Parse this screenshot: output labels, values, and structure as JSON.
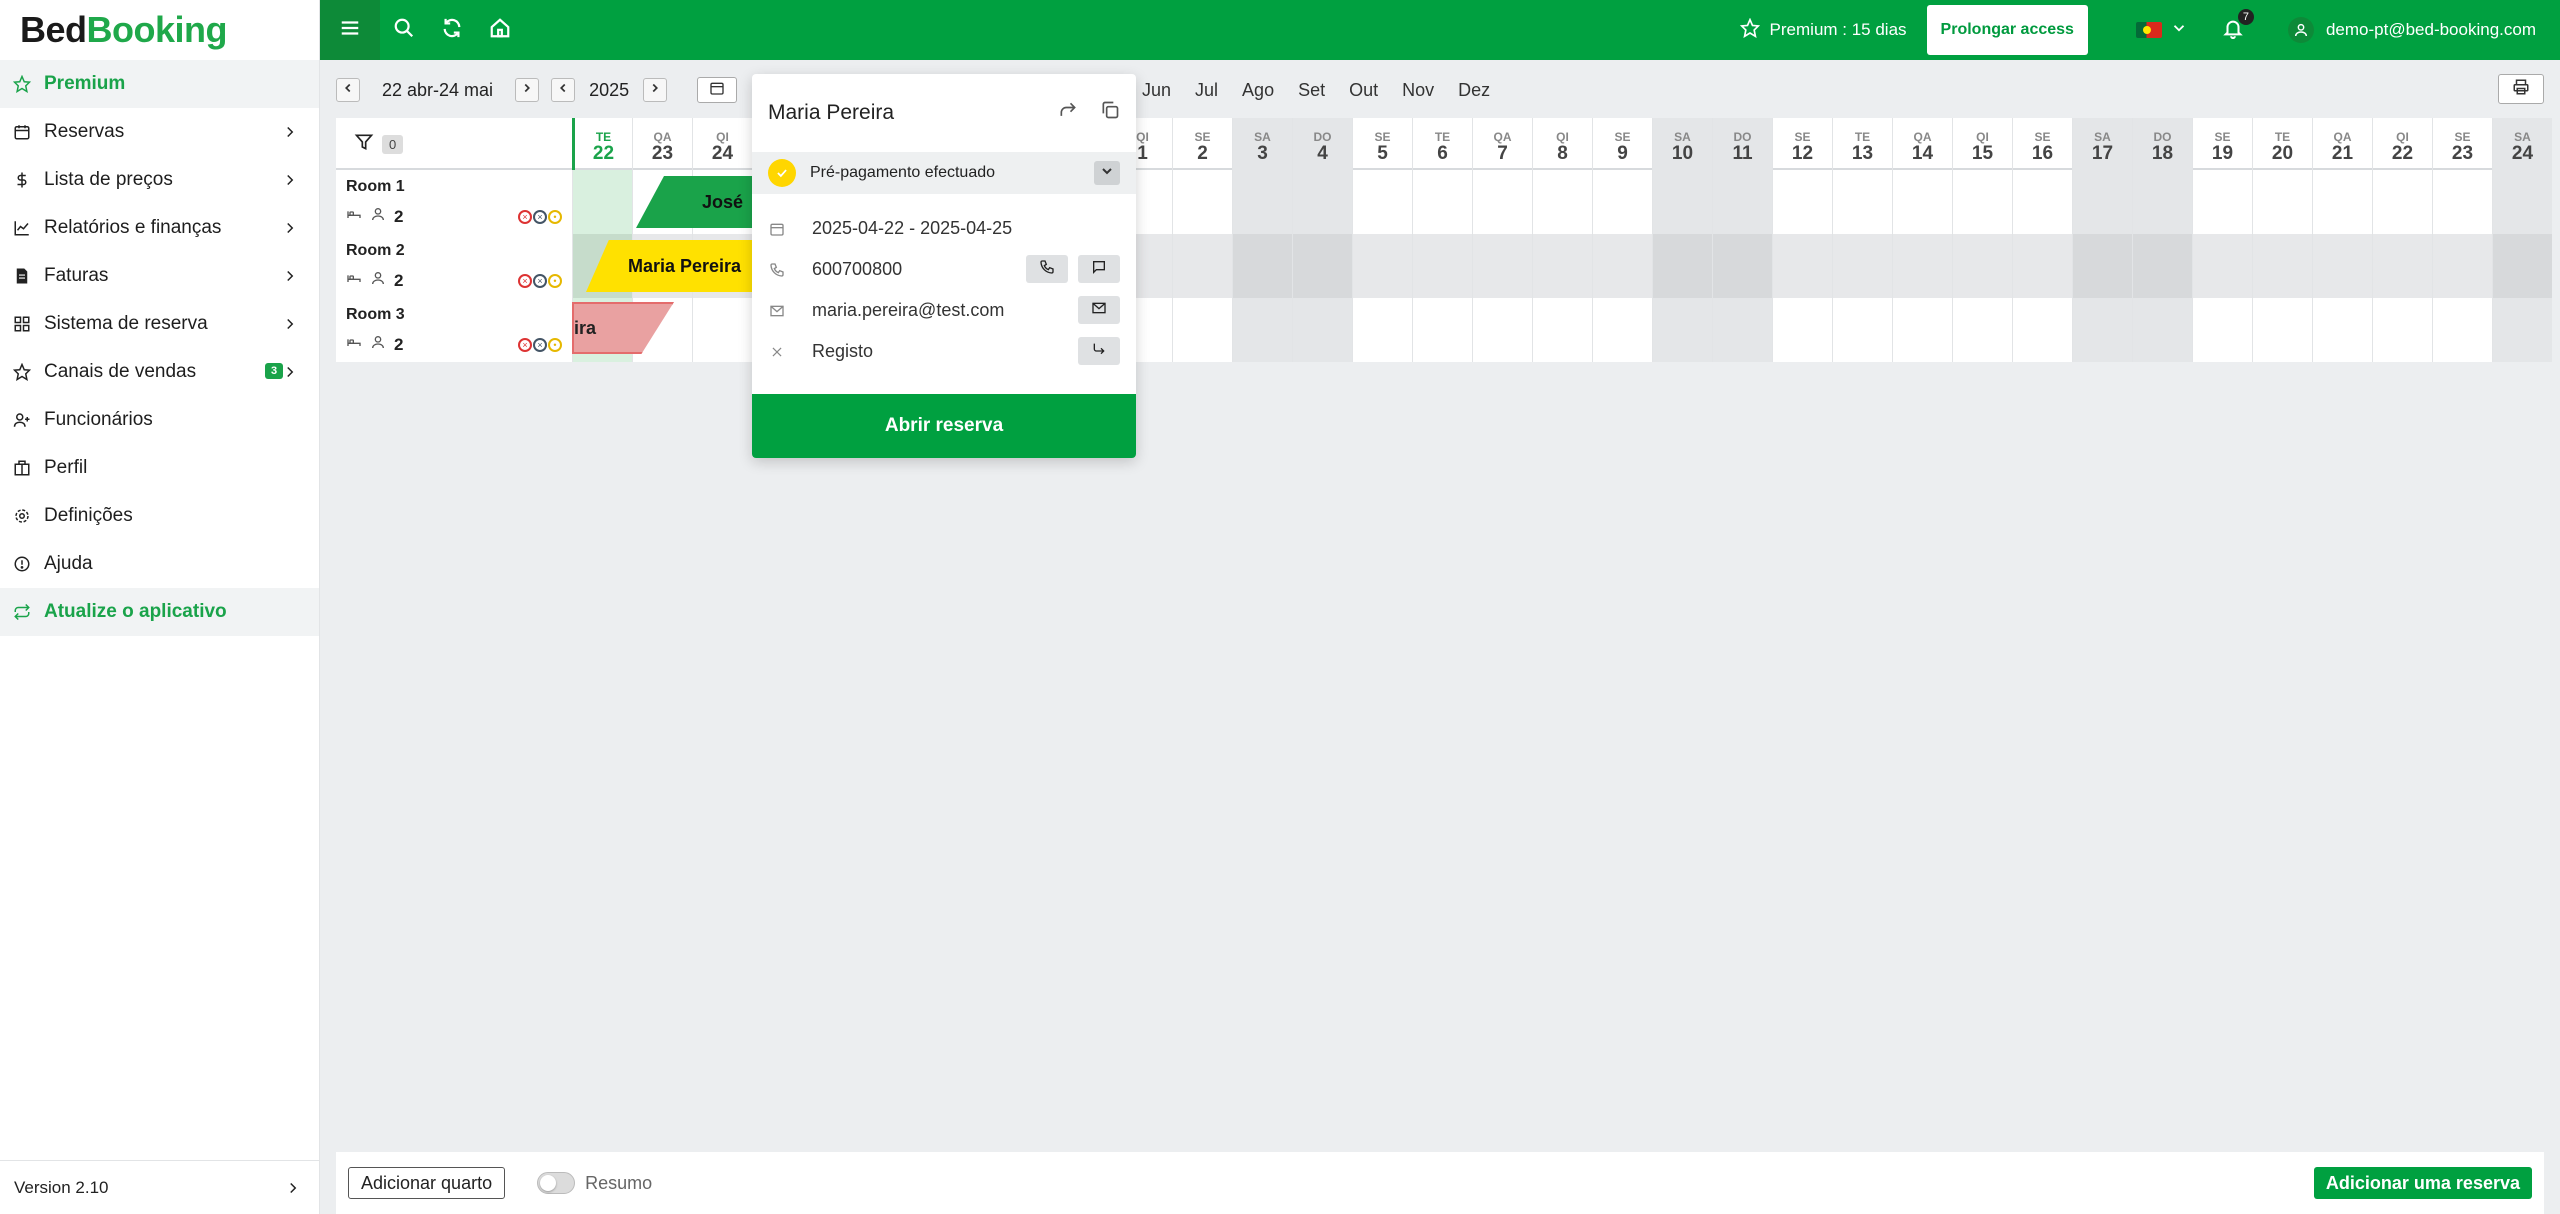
{
  "logo": {
    "part1": "Bed",
    "part2": "Booking"
  },
  "sidebar": {
    "items": [
      {
        "label": "Premium",
        "icon": "star-icon"
      },
      {
        "label": "Reservas",
        "icon": "calendar-icon"
      },
      {
        "label": "Lista de preços",
        "icon": "dollar-icon"
      },
      {
        "label": "Relatórios e finanças",
        "icon": "chart-icon"
      },
      {
        "label": "Faturas",
        "icon": "invoice-icon"
      },
      {
        "label": "Sistema de reserva",
        "icon": "grid-icon"
      },
      {
        "label": "Canais de vendas",
        "icon": "star-icon",
        "badge": "3"
      },
      {
        "label": "Funcionários",
        "icon": "user-plus-icon"
      },
      {
        "label": "Perfil",
        "icon": "building-icon"
      },
      {
        "label": "Definições",
        "icon": "gear-icon"
      },
      {
        "label": "Ajuda",
        "icon": "info-icon"
      },
      {
        "label": "Atualize o aplicativo",
        "icon": "refresh-icon"
      }
    ],
    "version": "Version 2.10"
  },
  "topbar": {
    "premium": "Premium : 15 dias",
    "prolong": "Prolongar access",
    "notifications": "7",
    "user": "demo-pt@bed-booking.com"
  },
  "toolbar": {
    "range": "22 abr-24 mai",
    "year": "2025",
    "months": [
      "Jun",
      "Jul",
      "Ago",
      "Set",
      "Out",
      "Nov",
      "Dez"
    ]
  },
  "grid": {
    "filter_count": "0",
    "days": [
      {
        "dw": "TE",
        "dn": "22"
      },
      {
        "dw": "QA",
        "dn": "23"
      },
      {
        "dw": "QI",
        "dn": "24"
      },
      {
        "dw": "",
        "dn": ""
      },
      {
        "dw": "",
        "dn": ""
      },
      {
        "dw": "",
        "dn": ""
      },
      {
        "dw": "",
        "dn": ""
      },
      {
        "dw": "",
        "dn": ""
      },
      {
        "dw": "",
        "dn": ""
      },
      {
        "dw": "QI",
        "dn": "1"
      },
      {
        "dw": "SE",
        "dn": "2"
      },
      {
        "dw": "SA",
        "dn": "3"
      },
      {
        "dw": "DO",
        "dn": "4"
      },
      {
        "dw": "SE",
        "dn": "5"
      },
      {
        "dw": "TE",
        "dn": "6"
      },
      {
        "dw": "QA",
        "dn": "7"
      },
      {
        "dw": "QI",
        "dn": "8"
      },
      {
        "dw": "SE",
        "dn": "9"
      },
      {
        "dw": "SA",
        "dn": "10"
      },
      {
        "dw": "DO",
        "dn": "11"
      },
      {
        "dw": "SE",
        "dn": "12"
      },
      {
        "dw": "TE",
        "dn": "13"
      },
      {
        "dw": "QA",
        "dn": "14"
      },
      {
        "dw": "QI",
        "dn": "15"
      },
      {
        "dw": "SE",
        "dn": "16"
      },
      {
        "dw": "SA",
        "dn": "17"
      },
      {
        "dw": "DO",
        "dn": "18"
      },
      {
        "dw": "SE",
        "dn": "19"
      },
      {
        "dw": "TE",
        "dn": "20"
      },
      {
        "dw": "QA",
        "dn": "21"
      },
      {
        "dw": "QI",
        "dn": "22"
      },
      {
        "dw": "SE",
        "dn": "23"
      },
      {
        "dw": "SA",
        "dn": "24"
      }
    ],
    "rooms": [
      {
        "name": "Room 1",
        "guests": "2"
      },
      {
        "name": "Room 2",
        "guests": "2"
      },
      {
        "name": "Room 3",
        "guests": "2"
      }
    ],
    "bookings": {
      "jose": "José",
      "maria": "Maria Pereira",
      "mira": "ira"
    }
  },
  "popup": {
    "name": "Maria Pereira",
    "status": "Pré-pagamento efectuado",
    "dates": "2025-04-22 - 2025-04-25",
    "phone": "600700800",
    "email": "maria.pereira@test.com",
    "registo": "Registo",
    "open": "Abrir reserva"
  },
  "bottombar": {
    "add_room": "Adicionar quarto",
    "summary": "Resumo",
    "add_booking": "Adicionar uma reserva"
  }
}
